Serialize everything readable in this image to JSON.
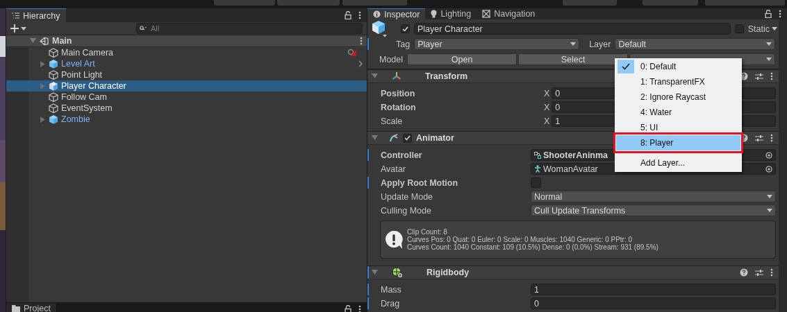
{
  "hierarchy": {
    "tab": "Hierarchy",
    "search": {
      "placeholder": "All"
    },
    "scene": {
      "name": "Main",
      "expanded": true
    },
    "items": [
      {
        "name": "Main Camera",
        "expandable": false,
        "prefab": false,
        "selected": false,
        "badge": true,
        "open_arrow": false
      },
      {
        "name": "Level Art",
        "expandable": true,
        "prefab": true,
        "selected": false,
        "badge": false,
        "open_arrow": true
      },
      {
        "name": "Point Light",
        "expandable": false,
        "prefab": false,
        "selected": false,
        "badge": false,
        "open_arrow": false
      },
      {
        "name": "Player Character",
        "expandable": true,
        "prefab": true,
        "selected": true,
        "badge": false,
        "open_arrow": false
      },
      {
        "name": "Follow Cam",
        "expandable": false,
        "prefab": false,
        "selected": false,
        "badge": false,
        "open_arrow": false
      },
      {
        "name": "EventSystem",
        "expandable": false,
        "prefab": false,
        "selected": false,
        "badge": false,
        "open_arrow": false
      },
      {
        "name": "Zombie",
        "expandable": true,
        "prefab": true,
        "selected": false,
        "badge": false,
        "open_arrow": false
      }
    ]
  },
  "project_tab": "Project",
  "inspector": {
    "tabs": [
      {
        "label": "Inspector",
        "selected": true,
        "kind": "info"
      },
      {
        "label": "Lighting",
        "selected": false,
        "kind": "bulb"
      },
      {
        "label": "Navigation",
        "selected": false,
        "kind": "nav"
      }
    ],
    "object": {
      "active": true,
      "name": "Player Character",
      "static": false,
      "static_label": "Static",
      "tag_label": "Tag",
      "tag": "Player",
      "layer_label": "Layer",
      "layer": "Default",
      "model_label": "Model",
      "model_buttons": [
        "Open",
        "Select"
      ]
    },
    "components": [
      {
        "kind": "transform",
        "title": "Transform",
        "override_bar": false,
        "rows": [
          {
            "kind": "vector",
            "label": "Position",
            "overridden": true,
            "override_bar": false,
            "axis": "X",
            "value": "0"
          },
          {
            "kind": "vector",
            "label": "Rotation",
            "overridden": true,
            "override_bar": false,
            "axis": "X",
            "value": "0"
          },
          {
            "kind": "vector",
            "label": "Scale",
            "overridden": false,
            "override_bar": false,
            "axis": "X",
            "value": "1"
          }
        ]
      },
      {
        "kind": "animator",
        "title": "Animator",
        "enabled": true,
        "override_bar": false,
        "rows": [
          {
            "kind": "object",
            "label": "Controller",
            "overridden": true,
            "override_bar": true,
            "value": "ShooterAninma"
          },
          {
            "kind": "object",
            "label": "Avatar",
            "overridden": false,
            "override_bar": false,
            "value": "WomanAvatar"
          },
          {
            "kind": "checkbox",
            "label": "Apply Root Motion",
            "overridden": true,
            "override_bar": true,
            "checked": false
          },
          {
            "kind": "dropdown",
            "label": "Update Mode",
            "overridden": false,
            "override_bar": false,
            "value": "Normal"
          },
          {
            "kind": "dropdown",
            "label": "Culling Mode",
            "overridden": false,
            "override_bar": false,
            "value": "Cull Update Transforms"
          },
          {
            "kind": "info",
            "lines": [
              "Clip Count: 8",
              "Curves Pos: 0 Quat: 0 Euler: 0 Scale: 0 Muscles: 1040 Generic: 0 PPtr: 0",
              "Curves Count: 1040 Constant: 109 (10.5%) Dense: 0 (0.0%) Stream: 931 (89.5%)"
            ]
          }
        ]
      },
      {
        "kind": "rigidbody",
        "title": "Rigidbody",
        "override_bar": true,
        "rows": [
          {
            "kind": "number",
            "label": "Mass",
            "overridden": false,
            "override_bar": true,
            "value": "1"
          },
          {
            "kind": "number",
            "label": "Drag",
            "overridden": false,
            "override_bar": true,
            "value": "0"
          }
        ]
      }
    ]
  },
  "layer_menu": {
    "items": [
      {
        "label": "0: Default",
        "checked": true,
        "selected": false,
        "annotated": false
      },
      {
        "label": "1: TransparentFX",
        "checked": false,
        "selected": false,
        "annotated": false
      },
      {
        "label": "2: Ignore Raycast",
        "checked": false,
        "selected": false,
        "annotated": false
      },
      {
        "label": "4: Water",
        "checked": false,
        "selected": false,
        "annotated": false
      },
      {
        "label": "5: UI",
        "checked": false,
        "selected": false,
        "annotated": false
      },
      {
        "label": "8: Player",
        "checked": false,
        "selected": true,
        "annotated": true
      }
    ],
    "footer": "Add Layer..."
  }
}
